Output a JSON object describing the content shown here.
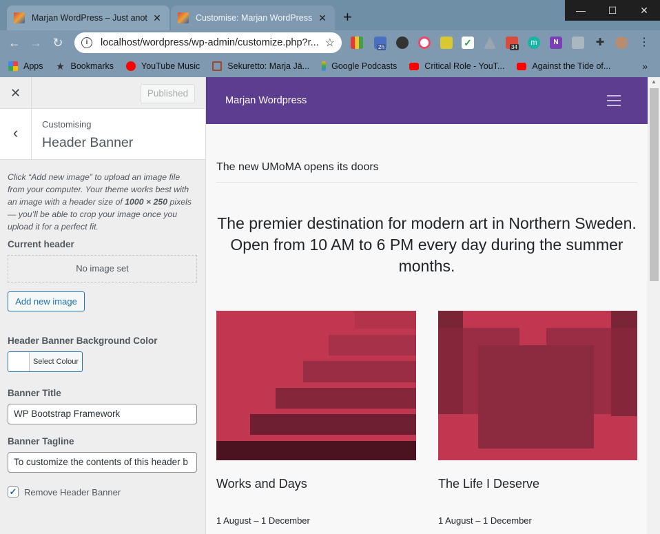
{
  "browser": {
    "tabs": [
      {
        "title": "Marjan WordPress – Just another",
        "active": false
      },
      {
        "title": "Customise: Marjan WordPress – J",
        "active": true
      }
    ],
    "new_tab_label": "+",
    "window_controls": {
      "minimize": "—",
      "maximize": "☐",
      "close": "✕"
    },
    "url": "localhost/wordpress/wp-admin/customize.php?r...",
    "extension_badges": {
      "2h": "2h",
      "34": "34"
    },
    "bookmarks": [
      {
        "label": "Apps",
        "icon": "apps-grid-icon",
        "color": "#e8453c"
      },
      {
        "label": "Bookmarks",
        "icon": "star-icon",
        "color": "#333333"
      },
      {
        "label": "YouTube Music",
        "icon": "youtube-music-icon",
        "color": "#ff0000"
      },
      {
        "label": "Sekuretto: Marja Jä...",
        "icon": "sekuretto-icon",
        "color": "#a0422f"
      },
      {
        "label": "Google Podcasts",
        "icon": "google-podcasts-icon",
        "color": "#f4b400"
      },
      {
        "label": "Critical Role - YouT...",
        "icon": "youtube-icon",
        "color": "#ff0000"
      },
      {
        "label": "Against the Tide of...",
        "icon": "youtube-icon",
        "color": "#ff0000"
      }
    ],
    "bookmarks_more": "»"
  },
  "customizer": {
    "close_icon": "✕",
    "publish_label": "Published",
    "back_icon": "‹",
    "breadcrumb": "Customising",
    "section_title": "Header Banner",
    "description_parts": [
      "Click “Add new image” to upload an image file from your computer. Your theme works best with an image with a header size of ",
      "1000 × 250",
      " pixels — you’ll be able to crop your image once you upload it for a perfect fit."
    ],
    "current_header_label": "Current header",
    "no_image_text": "No image set",
    "add_image_label": "Add new image",
    "bg_color_label": "Header Banner Background Color",
    "select_colour_label": "Select Colour",
    "banner_title_label": "Banner Title",
    "banner_title_value": "WP Bootstrap Framework",
    "banner_tagline_label": "Banner Tagline",
    "banner_tagline_value": "To customize the contents of this header b",
    "remove_banner_label": "Remove Header Banner",
    "remove_banner_checked": true
  },
  "preview": {
    "brand": "Marjan Wordpress",
    "headline": "The new UMoMA opens its doors",
    "lead": "The premier destination for modern art in Northern Sweden. Open from 10 AM to 6 PM every day during the summer months.",
    "cards": [
      {
        "title": "Works and Days",
        "date": "1 August – 1 December"
      },
      {
        "title": "The Life I Deserve",
        "date": "1 August – 1 December"
      }
    ],
    "colors": {
      "navbar": "#5d3d8f",
      "card_base": "#c0374f"
    }
  }
}
